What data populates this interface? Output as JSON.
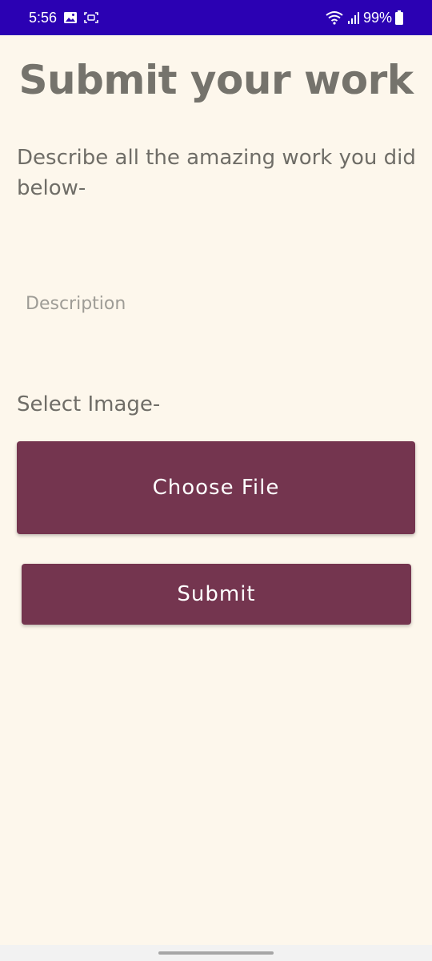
{
  "status_bar": {
    "time": "5:56",
    "battery": "99%",
    "background_color": "#2B01B3",
    "icons_left": [
      "image-icon",
      "screenshot-icon"
    ],
    "icons_right": [
      "wifi-icon",
      "signal-icon",
      "battery-icon"
    ]
  },
  "page": {
    "title": "Submit your work",
    "intro": "Describe all the amazing work you did below-",
    "description": {
      "placeholder": "Description",
      "value": ""
    },
    "select_image_label": "Select Image-",
    "choose_file_label": "Choose File",
    "submit_label": "Submit"
  },
  "colors": {
    "background": "#FDF7EC",
    "button": "#74354F",
    "text": "#6F6D67",
    "title": "#75736C"
  }
}
